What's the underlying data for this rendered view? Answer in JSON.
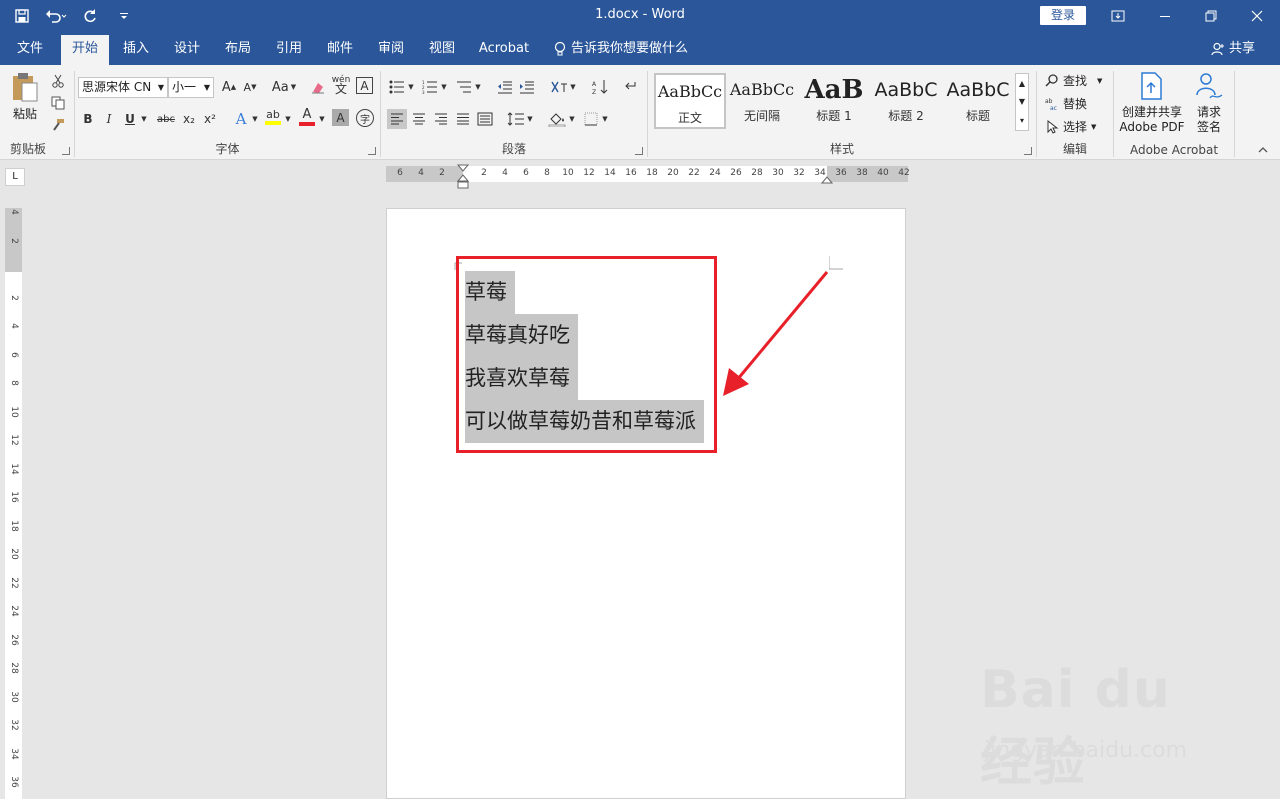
{
  "window": {
    "title": "1.docx  -  Word",
    "login": "登录"
  },
  "tabs": [
    "文件",
    "开始",
    "插入",
    "设计",
    "布局",
    "引用",
    "邮件",
    "审阅",
    "视图",
    "Acrobat"
  ],
  "active_tab": "开始",
  "tell_me": "告诉我你想要做什么",
  "share": "共享",
  "ribbon": {
    "clipboard": {
      "label": "剪贴板",
      "paste": "粘贴"
    },
    "font": {
      "label": "字体",
      "font_name": "思源宋体 CN",
      "font_size": "小一",
      "case_btn": "Aa",
      "phonetic": "wén",
      "border_char": "A",
      "bold": "B",
      "italic": "I",
      "underline": "U",
      "strike": "abc",
      "subscript": "x₂",
      "superscript": "x²",
      "grow": "A",
      "shrink": "A",
      "text_effect": "A",
      "highlight": "ab",
      "font_color": "A",
      "char_shade": "A",
      "enclose": "字"
    },
    "paragraph": {
      "label": "段落"
    },
    "styles": {
      "label": "样式",
      "items": [
        {
          "sample": "AaBbCc",
          "name": "正文"
        },
        {
          "sample": "AaBbCc",
          "name": "无间隔"
        },
        {
          "sample": "AaB",
          "name": "标题 1"
        },
        {
          "sample": "AaBbC",
          "name": "标题 2"
        },
        {
          "sample": "AaBbC",
          "name": "标题"
        }
      ]
    },
    "editing": {
      "label": "编辑",
      "find": "查找",
      "replace": "替换",
      "select": "选择"
    },
    "acrobat": {
      "label": "Adobe Acrobat",
      "create_pdf_1": "创建并共享",
      "create_pdf_2": "Adobe PDF",
      "sign_1": "请求",
      "sign_2": "签名"
    }
  },
  "ruler": {
    "corner": "L",
    "h_ticks": [
      "6",
      "4",
      "2",
      "2",
      "4",
      "6",
      "8",
      "10",
      "12",
      "14",
      "16",
      "18",
      "20",
      "22",
      "24",
      "26",
      "28",
      "30",
      "32",
      "34",
      "36",
      "38",
      "40",
      "42"
    ],
    "v_ticks": [
      "4",
      "2",
      "2",
      "4",
      "6",
      "8",
      "10",
      "12",
      "14",
      "16",
      "18",
      "20",
      "22",
      "24",
      "26",
      "28",
      "30",
      "32",
      "34",
      "36"
    ]
  },
  "document": {
    "lines": [
      "草莓",
      "草莓真好吃",
      "我喜欢草莓",
      "可以做草莓奶昔和草莓派"
    ]
  },
  "watermark": {
    "logo": "Bai du 经验",
    "url": "jingyan.baidu.com"
  },
  "colors": {
    "brand": "#2b579a",
    "annotation": "#e8202a",
    "selection": "#c6c6c6"
  }
}
